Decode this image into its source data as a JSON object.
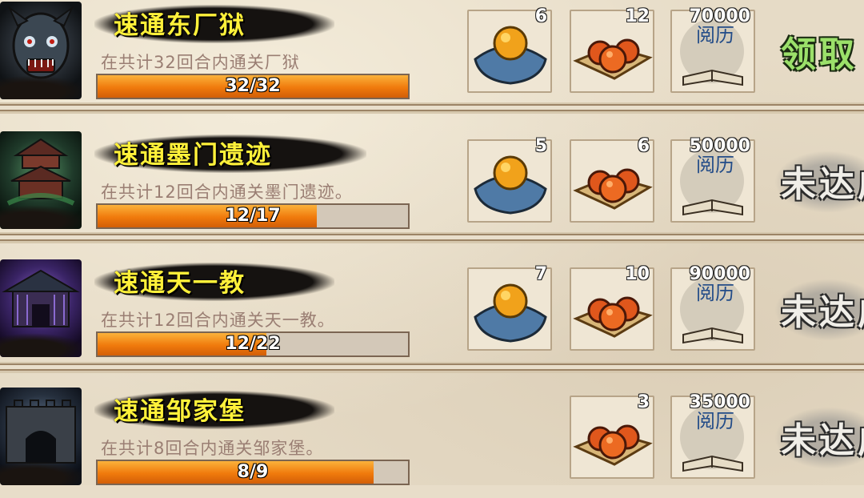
{
  "tasks": [
    {
      "title": "速通东厂狱",
      "description": "在共计32回合内通关厂狱",
      "progress_text": "32/32",
      "progress_fraction": 1.0,
      "rewards": [
        {
          "icon": "gold-orb-on-cushion-icon",
          "count": "6"
        },
        {
          "icon": "orange-fruits-on-cloth-icon",
          "count": "12"
        },
        {
          "icon": "experience-book-icon",
          "book_label": "阅历",
          "count": "70000"
        }
      ],
      "button_label": "领取",
      "button_state": "claimable"
    },
    {
      "title": "速通墨门遗迹",
      "description": "在共计12回合内通关墨门遗迹。",
      "progress_text": "12/17",
      "progress_fraction": 0.706,
      "rewards": [
        {
          "icon": "gold-orb-on-cushion-icon",
          "count": "5"
        },
        {
          "icon": "orange-fruits-on-cloth-icon",
          "count": "6"
        },
        {
          "icon": "experience-book-icon",
          "book_label": "阅历",
          "count": "50000"
        }
      ],
      "button_label": "未达成",
      "button_state": "locked"
    },
    {
      "title": "速通天一教",
      "description": "在共计12回合内通关天一教。",
      "progress_text": "12/22",
      "progress_fraction": 0.545,
      "rewards": [
        {
          "icon": "gold-orb-on-cushion-icon",
          "count": "7"
        },
        {
          "icon": "orange-fruits-on-cloth-icon",
          "count": "10"
        },
        {
          "icon": "experience-book-icon",
          "book_label": "阅历",
          "count": "90000"
        }
      ],
      "button_label": "未达成",
      "button_state": "locked"
    },
    {
      "title": "速通邹家堡",
      "description": "在共计8回合内通关邹家堡。",
      "progress_text": "8/9",
      "progress_fraction": 0.889,
      "rewards": [
        {
          "icon": "orange-fruits-on-cloth-icon",
          "count": "3"
        },
        {
          "icon": "experience-book-icon",
          "book_label": "阅历",
          "count": "35000"
        }
      ],
      "button_label": "未达成",
      "button_state": "locked"
    }
  ],
  "colors": {
    "title_yellow": "#fff13a",
    "description_text": "#9a7e73",
    "progress_orange": "#f07a0c",
    "claim_green": "#9be06a"
  }
}
